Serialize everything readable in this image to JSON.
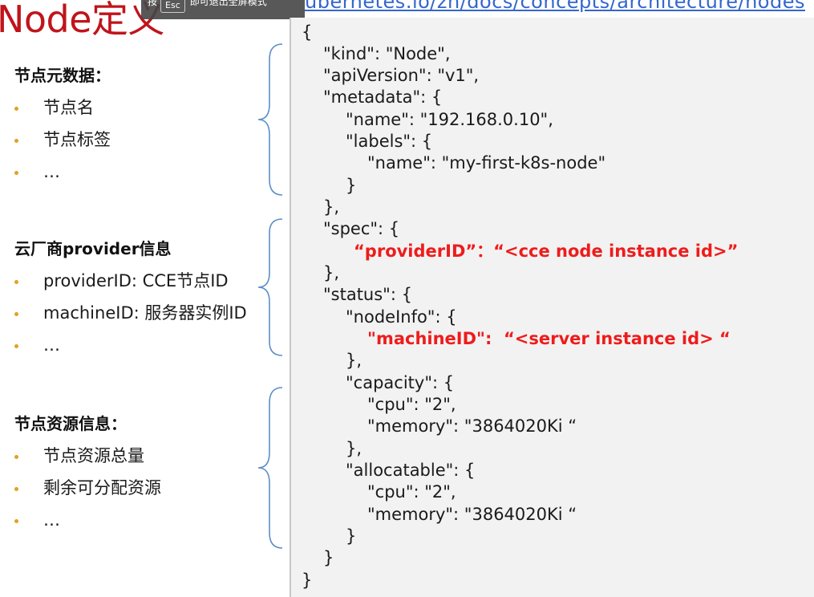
{
  "title": "Node定义",
  "esc_hint": {
    "pre": "按",
    "key": "Esc",
    "post": "即可退出全屏模式"
  },
  "url_fragment": "ubernetes.io/zh/docs/concepts/architecture/nodes",
  "sections": [
    {
      "heading": "节点元数据：",
      "items": [
        "节点名",
        "节点标签",
        "…"
      ]
    },
    {
      "heading": "云厂商provider信息",
      "items": [
        "providerID: CCE节点ID",
        "machineID: 服务器实例ID",
        "…"
      ]
    },
    {
      "heading": "节点资源信息：",
      "items": [
        "节点资源总量",
        "剩余可分配资源",
        "…"
      ]
    }
  ],
  "code_lines": [
    "{",
    "\"kind\": \"Node\",",
    "\"apiVersion\": \"v1\",",
    "\"metadata\": {",
    "\"name\": \"192.168.0.10\",",
    "\"labels\": {",
    "\"name\": \"my-first-k8s-node\"",
    "}",
    "},",
    "\"spec\": {",
    "“providerID”：“<cce node instance id>”",
    "},",
    "\"status\": {",
    "\"nodeInfo\": {",
    "\"machineID\":  “<server instance id> “",
    "},",
    "\"capacity\": {",
    "\"cpu\": \"2\",",
    "\"memory\": \"3864020Ki “",
    "},",
    "\"allocatable\": {",
    "\"cpu\": \"2\",",
    "\"memory\": \"3864020Ki “",
    "}",
    "}",
    "}"
  ],
  "colors": {
    "title": "#c0141b",
    "highlight": "#ee1c1c",
    "bullet": "#e3a11c",
    "brace": "#5b8fc7",
    "panel": "#f2f2f2"
  }
}
